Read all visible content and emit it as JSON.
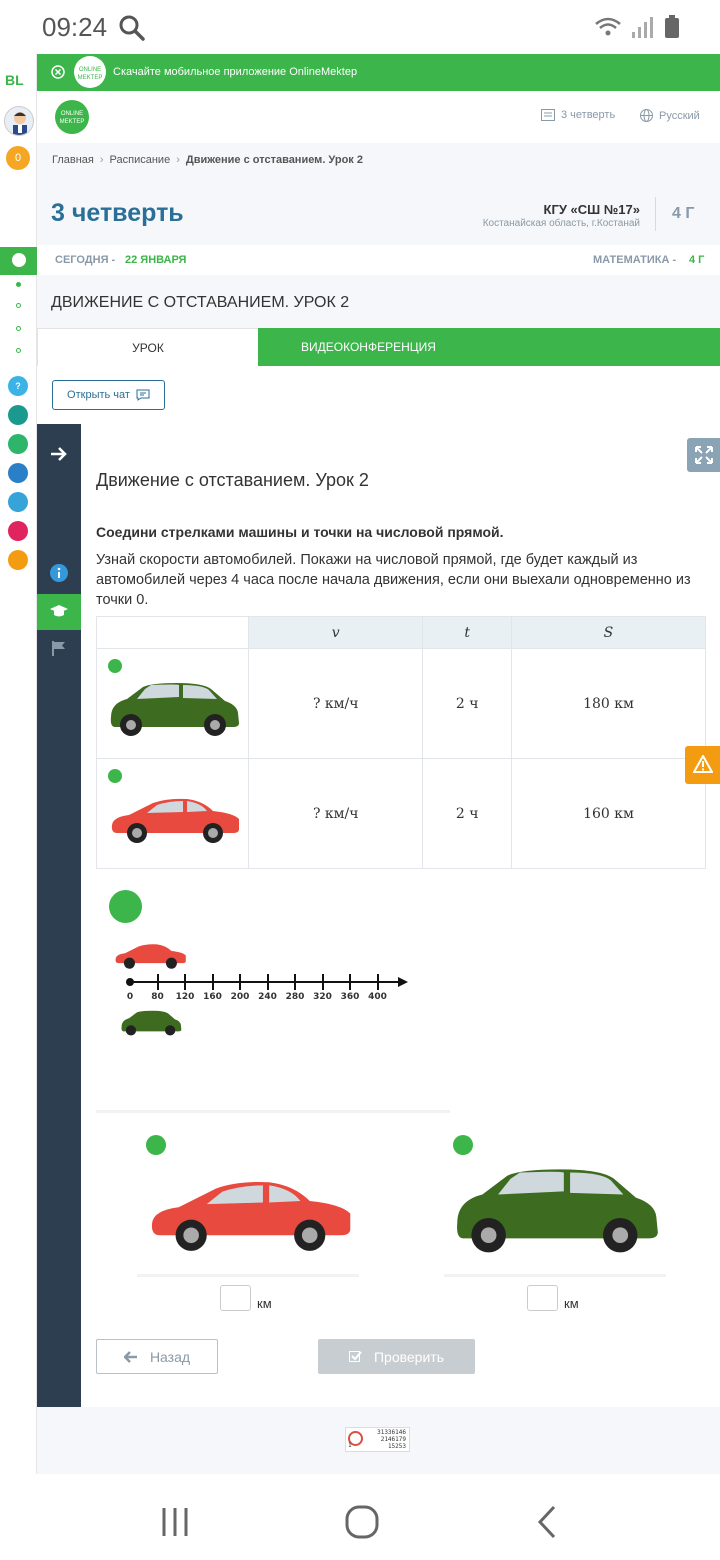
{
  "status": {
    "time": "09:24"
  },
  "rail": {
    "logo": "BL",
    "badge": "0",
    "help": "?"
  },
  "banner": {
    "text": "Скачайте мобильное приложение OnlineMektep"
  },
  "header": {
    "logo_text": "ONLINE MEKTEP",
    "quarter_link": "3 четверть",
    "language": "Русский"
  },
  "breadcrumb": {
    "home": "Главная",
    "schedule": "Расписание",
    "current": "Движение с отставанием. Урок 2"
  },
  "quarter": {
    "title": "3 четверть",
    "school": "КГУ «СШ №17»",
    "region": "Костанайская область, г.Костанай",
    "grade": "4 Г"
  },
  "dateline": {
    "today_label": "СЕГОДНЯ -",
    "today_date": "22 ЯНВАРЯ",
    "subject_label": "МАТЕМАТИКА -",
    "subject_grade": "4 Г"
  },
  "lesson": {
    "title": "ДВИЖЕНИЕ С ОТСТАВАНИЕМ. УРОК 2"
  },
  "tabs": {
    "lesson": "УРОК",
    "video": "ВИДЕОКОНФЕРЕНЦИЯ"
  },
  "chat": {
    "button": "Открыть чат"
  },
  "task": {
    "title": "Движение с отставанием. Урок 2",
    "bold": "Соедини стрелками машины и точки на числовой прямой.",
    "desc": "Узнай скорости автомобилей. Покажи на числовой прямой, где будет каждый из автомобилей через 4 часа после начала движения, если они выехали одновременно из точки 0.",
    "table": {
      "headers": [
        "v",
        "t",
        "S"
      ],
      "rows": [
        {
          "v": "? км/ч",
          "t": "2 ч",
          "s": "180 км"
        },
        {
          "v": "? км/ч",
          "t": "2 ч",
          "s": "160 км"
        }
      ]
    },
    "numberline": [
      "0",
      "80",
      "120",
      "160",
      "200",
      "240",
      "280",
      "320",
      "360",
      "400"
    ],
    "unit": "км",
    "answer_red": "",
    "answer_green": ""
  },
  "buttons": {
    "back": "Назад",
    "check": "Проверить"
  },
  "footer": {
    "counter_lines": [
      "31336146",
      "2146179",
      "15253"
    ],
    "counter_left": "1"
  },
  "colors": {
    "green": "#3cb54a",
    "dark": "#2c3e50",
    "blue": "#2a6f97",
    "orange": "#f39c12",
    "red_car": "#e84a3f",
    "green_car": "#3d6b1f"
  }
}
